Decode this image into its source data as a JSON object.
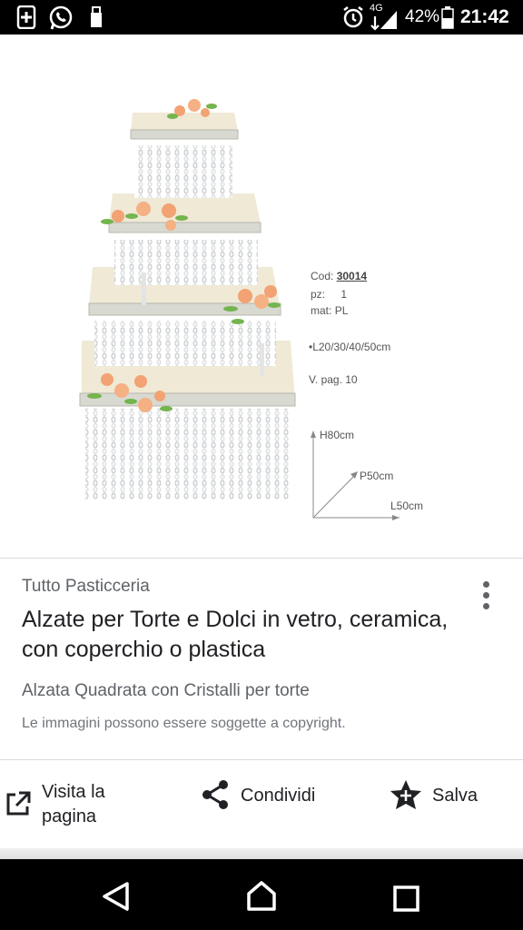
{
  "status_bar": {
    "battery": "42%",
    "time": "21:42",
    "network": "4G",
    "icons": [
      "tablet-plus-icon",
      "whatsapp-icon",
      "usb-icon",
      "alarm-icon",
      "signal-icon",
      "battery-icon"
    ]
  },
  "image": {
    "specs": {
      "code_label": "Cod:",
      "code_value": "30014",
      "pz_label": "pz:",
      "pz_value": "1",
      "mat_label": "mat:",
      "mat_value": "PL",
      "sizes": "•L20/30/40/50cm",
      "page_ref": "V. pag. 10",
      "height": "H80cm",
      "depth": "P50cm",
      "length": "L50cm"
    }
  },
  "result": {
    "source": "Tutto Pasticceria",
    "title": "Alzate per Torte e Dolci in vetro, ceramica, con coperchio o plastica",
    "description": "Alzata Quadrata con Cristalli per torte",
    "copyright": "Le immagini possono essere soggette a copyright."
  },
  "actions": {
    "visit_line1": "Visita la",
    "visit_line2": "pagina",
    "share": "Condividi",
    "save": "Salva"
  },
  "nav": {
    "icons": [
      "back-icon",
      "home-icon",
      "recents-icon"
    ]
  }
}
